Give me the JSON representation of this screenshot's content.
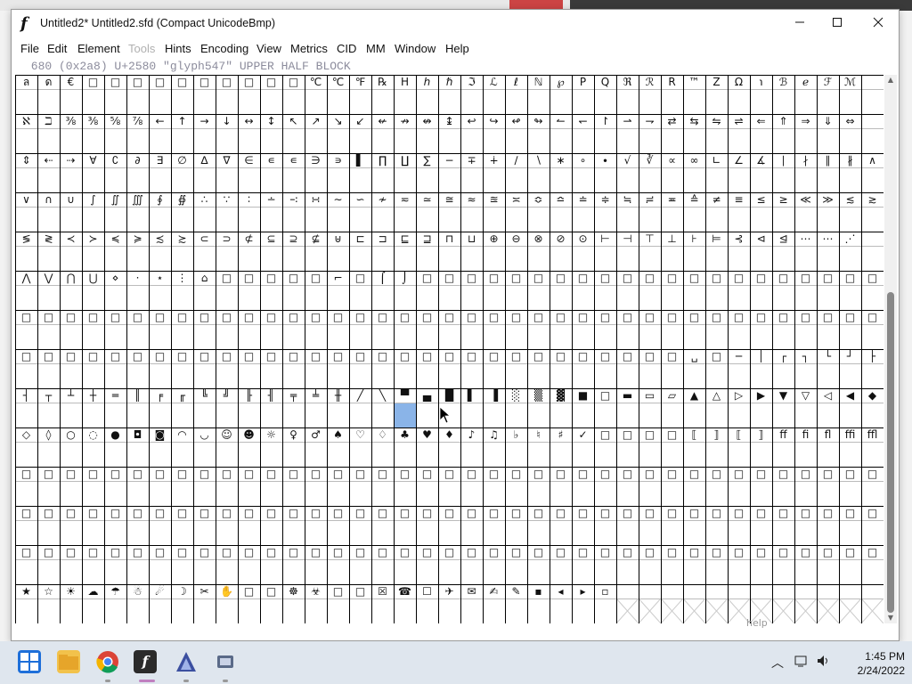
{
  "window": {
    "title": "Untitled2*  Untitled2.sfd (Compact UnicodeBmp)",
    "minimize_icon": "minimize-icon",
    "maximize_icon": "maximize-icon",
    "close_icon": "close-icon"
  },
  "menu": [
    {
      "label": "File",
      "enabled": true
    },
    {
      "label": "Edit",
      "enabled": true
    },
    {
      "label": "Element",
      "enabled": true
    },
    {
      "label": "Tools",
      "enabled": false
    },
    {
      "label": "Hints",
      "enabled": true
    },
    {
      "label": "Encoding",
      "enabled": true
    },
    {
      "label": "View",
      "enabled": true
    },
    {
      "label": "Metrics",
      "enabled": true
    },
    {
      "label": "CID",
      "enabled": true
    },
    {
      "label": "MM",
      "enabled": true
    },
    {
      "label": "Window",
      "enabled": true
    },
    {
      "label": "Help",
      "enabled": true
    }
  ],
  "info_line": " 680 (0x2a8) U+2580 \"glyph547\" UPPER HALF BLOCK",
  "glyph_rows": [
    [
      "ล",
      "ด",
      "€",
      "□",
      "□",
      "□",
      "□",
      "□",
      "□",
      "□",
      "□",
      "□",
      "□",
      "℃",
      "℃",
      "℉",
      "℞",
      "H",
      "ℎ",
      "ℏ",
      "ℑ",
      "ℒ",
      "ℓ",
      "ℕ",
      "℘",
      "P",
      "Q",
      "ℜ",
      "ℛ",
      "R",
      "™",
      "Z",
      "Ω",
      "℩",
      "ℬ",
      "ℯ",
      "ℱ",
      "ℳ"
    ],
    [
      "ℵ",
      "ℶ",
      "⅜",
      "⅜",
      "⅝",
      "⅞",
      "←",
      "↑",
      "→",
      "↓",
      "↔",
      "↕",
      "↖",
      "↗",
      "↘",
      "↙",
      "↚",
      "↛",
      "↮",
      "↨",
      "↩",
      "↪",
      "↫",
      "↬",
      "↼",
      "↽",
      "↾",
      "⇀",
      "⇁",
      "⇄",
      "⇆",
      "⇋",
      "⇌",
      "⇐",
      "⇑",
      "⇒",
      "⇓",
      "⇔"
    ],
    [
      "⇕",
      "⇠",
      "⇢",
      "∀",
      "∁",
      "∂",
      "∃",
      "∅",
      "∆",
      "∇",
      "∈",
      "∊",
      "∊",
      "∋",
      "∍",
      "▌",
      "∏",
      "∐",
      "∑",
      "−",
      "∓",
      "∔",
      "∕",
      "∖",
      "∗",
      "∘",
      "∙",
      "√",
      "∛",
      "∝",
      "∞",
      "∟",
      "∠",
      "∡",
      "∣",
      "∤",
      "∥",
      "∦",
      "∧"
    ],
    [
      "∨",
      "∩",
      "∪",
      "∫",
      "∬",
      "∭",
      "∮",
      "∯",
      "∴",
      "∵",
      "∶",
      "∸",
      "∹",
      "∺",
      "∼",
      "∽",
      "≁",
      "≂",
      "≃",
      "≅",
      "≈",
      "≊",
      "≍",
      "≎",
      "≏",
      "≐",
      "≑",
      "≒",
      "≓",
      "≖",
      "≙",
      "≠",
      "≡",
      "≤",
      "≥",
      "≪",
      "≫",
      "≲",
      "≳"
    ],
    [
      "≶",
      "≷",
      "≺",
      "≻",
      "≼",
      "≽",
      "≾",
      "≿",
      "⊂",
      "⊃",
      "⊄",
      "⊆",
      "⊇",
      "⊈",
      "⊎",
      "⊏",
      "⊐",
      "⊑",
      "⊒",
      "⊓",
      "⊔",
      "⊕",
      "⊖",
      "⊗",
      "⊘",
      "⊙",
      "⊢",
      "⊣",
      "⊤",
      "⊥",
      "⊦",
      "⊨",
      "⊰",
      "⊲",
      "⊴",
      "⋯",
      "⋯",
      "⋰"
    ],
    [
      "⋀",
      "⋁",
      "⋂",
      "⋃",
      "⋄",
      "⋅",
      "⋆",
      "⋮",
      "⌂",
      "□",
      "□",
      "□",
      "□",
      "□",
      "⌐",
      "□",
      "⌠",
      "⌡",
      "□",
      "□",
      "□",
      "□",
      "□",
      "□",
      "□",
      "□",
      "□",
      "□",
      "□",
      "□",
      "□",
      "□",
      "□",
      "□",
      "□",
      "□",
      "□",
      "□",
      "□"
    ],
    [
      "□",
      "□",
      "□",
      "□",
      "□",
      "□",
      "□",
      "□",
      "□",
      "□",
      "□",
      "□",
      "□",
      "□",
      "□",
      "□",
      "□",
      "□",
      "□",
      "□",
      "□",
      "□",
      "□",
      "□",
      "□",
      "□",
      "□",
      "□",
      "□",
      "□",
      "□",
      "□",
      "□",
      "□",
      "□",
      "□",
      "□",
      "□",
      "□"
    ],
    [
      "□",
      "□",
      "□",
      "□",
      "□",
      "□",
      "□",
      "□",
      "□",
      "□",
      "□",
      "□",
      "□",
      "□",
      "□",
      "□",
      "□",
      "□",
      "□",
      "□",
      "□",
      "□",
      "□",
      "□",
      "□",
      "□",
      "□",
      "□",
      "□",
      "□",
      "␣",
      "□",
      "─",
      "│",
      "┌",
      "┐",
      "└",
      "┘",
      "├"
    ],
    [
      "┤",
      "┬",
      "┴",
      "┼",
      "═",
      "║",
      "╒",
      "╓",
      "╚",
      "╝",
      "╟",
      "╢",
      "╤",
      "╧",
      "╫",
      "╱",
      "╲",
      "▀",
      "▄",
      "█",
      "▌",
      "▐",
      "░",
      "▒",
      "▓",
      "■",
      "□",
      "▬",
      "▭",
      "▱",
      "▲",
      "△",
      "▷",
      "▶",
      "▼",
      "▽",
      "◁",
      "◀",
      "◆"
    ],
    [
      "◇",
      "◊",
      "○",
      "◌",
      "●",
      "◘",
      "◙",
      "◠",
      "◡",
      "☺",
      "☻",
      "☼",
      "♀",
      "♂",
      "♠",
      "♡",
      "♢",
      "♣",
      "♥",
      "♦",
      "♪",
      "♫",
      "♭",
      "♮",
      "♯",
      "✓",
      "□",
      "□",
      "□",
      "□",
      "⟦",
      "⟧",
      "⟦",
      "⟧",
      "ﬀ",
      "ﬁ",
      "ﬂ",
      "ﬃ",
      "ﬄ"
    ],
    [
      "□",
      "□",
      "□",
      "□",
      "□",
      "□",
      "□",
      "□",
      "□",
      "□",
      "□",
      "□",
      "□",
      "□",
      "□",
      "□",
      "□",
      "□",
      "□",
      "□",
      "□",
      "□",
      "□",
      "□",
      "□",
      "□",
      "□",
      "□",
      "□",
      "□",
      "□",
      "□",
      "□",
      "□",
      "□",
      "□",
      "□",
      "□",
      "□"
    ],
    [
      "□",
      "□",
      "□",
      "□",
      "□",
      "□",
      "□",
      "□",
      "□",
      "□",
      "□",
      "□",
      "□",
      "□",
      "□",
      "□",
      "□",
      "□",
      "□",
      "□",
      "□",
      "□",
      "□",
      "□",
      "□",
      "□",
      "□",
      "□",
      "□",
      "□",
      "□",
      "□",
      "□",
      "□",
      "□",
      "□",
      "□",
      "□",
      "□"
    ],
    [
      "□",
      "□",
      "□",
      "□",
      "□",
      "□",
      "□",
      "□",
      "□",
      "□",
      "□",
      "□",
      "□",
      "□",
      "□",
      "□",
      "□",
      "□",
      "□",
      "□",
      "□",
      "□",
      "□",
      "□",
      "□",
      "□",
      "□",
      "□",
      "□",
      "□",
      "□",
      "□",
      "□",
      "□",
      "□",
      "□",
      "□",
      "□",
      "□"
    ],
    [
      "★",
      "☆",
      "☀",
      "☁",
      "☂",
      "☃",
      "☄",
      "☽",
      "✂",
      "✋",
      "□",
      "□",
      "☸",
      "☣",
      "□",
      "□",
      "☒",
      "☎",
      "☐",
      "✈",
      "✉",
      "✍",
      "✎",
      "▪",
      "◂",
      "▸",
      "▫",
      "",
      "",
      "",
      "",
      "",
      "",
      "",
      "",
      "",
      "",
      "",
      ""
    ]
  ],
  "selected_glyph": "▀",
  "status_text": "help",
  "taskbar": {
    "apps": [
      {
        "name": "windows-start-icon"
      },
      {
        "name": "file-explorer-icon"
      },
      {
        "name": "chrome-icon"
      },
      {
        "name": "fontforge-icon"
      },
      {
        "name": "app-a-icon"
      },
      {
        "name": "app-b-icon"
      }
    ],
    "time": "1:45 PM",
    "date": "2/24/2022"
  }
}
